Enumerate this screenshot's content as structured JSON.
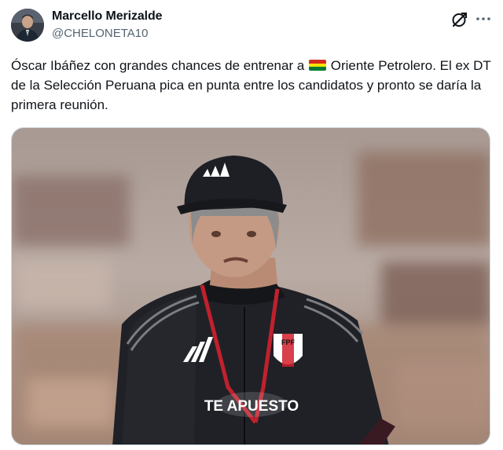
{
  "author": {
    "name": "Marcello Merizalde",
    "handle": "@CHELONETA10",
    "avatar_icon": "profile-photo"
  },
  "actions": {
    "grok_icon": "grok-icon",
    "more_icon": "more-dots-icon"
  },
  "post": {
    "text_before_flag": "Óscar Ibáñez con grandes chances de entrenar a ",
    "flag_icon": "bolivia-flag-icon",
    "text_after_flag": " Oriente Petrolero. El ex DT de la Selección Peruana pica en punta entre los candidatos y pronto se daría la primera reunión."
  },
  "media": {
    "description_icon": "photo-coach-in-training-gear",
    "crest_text": "FPF",
    "sponsor_text": "TE APUESTO"
  },
  "colors": {
    "text": "#0f1419",
    "secondary": "#536471",
    "border": "#cfd9de",
    "bolivia_red": "#d52b1e",
    "bolivia_yellow": "#f9e300",
    "bolivia_green": "#007934"
  }
}
